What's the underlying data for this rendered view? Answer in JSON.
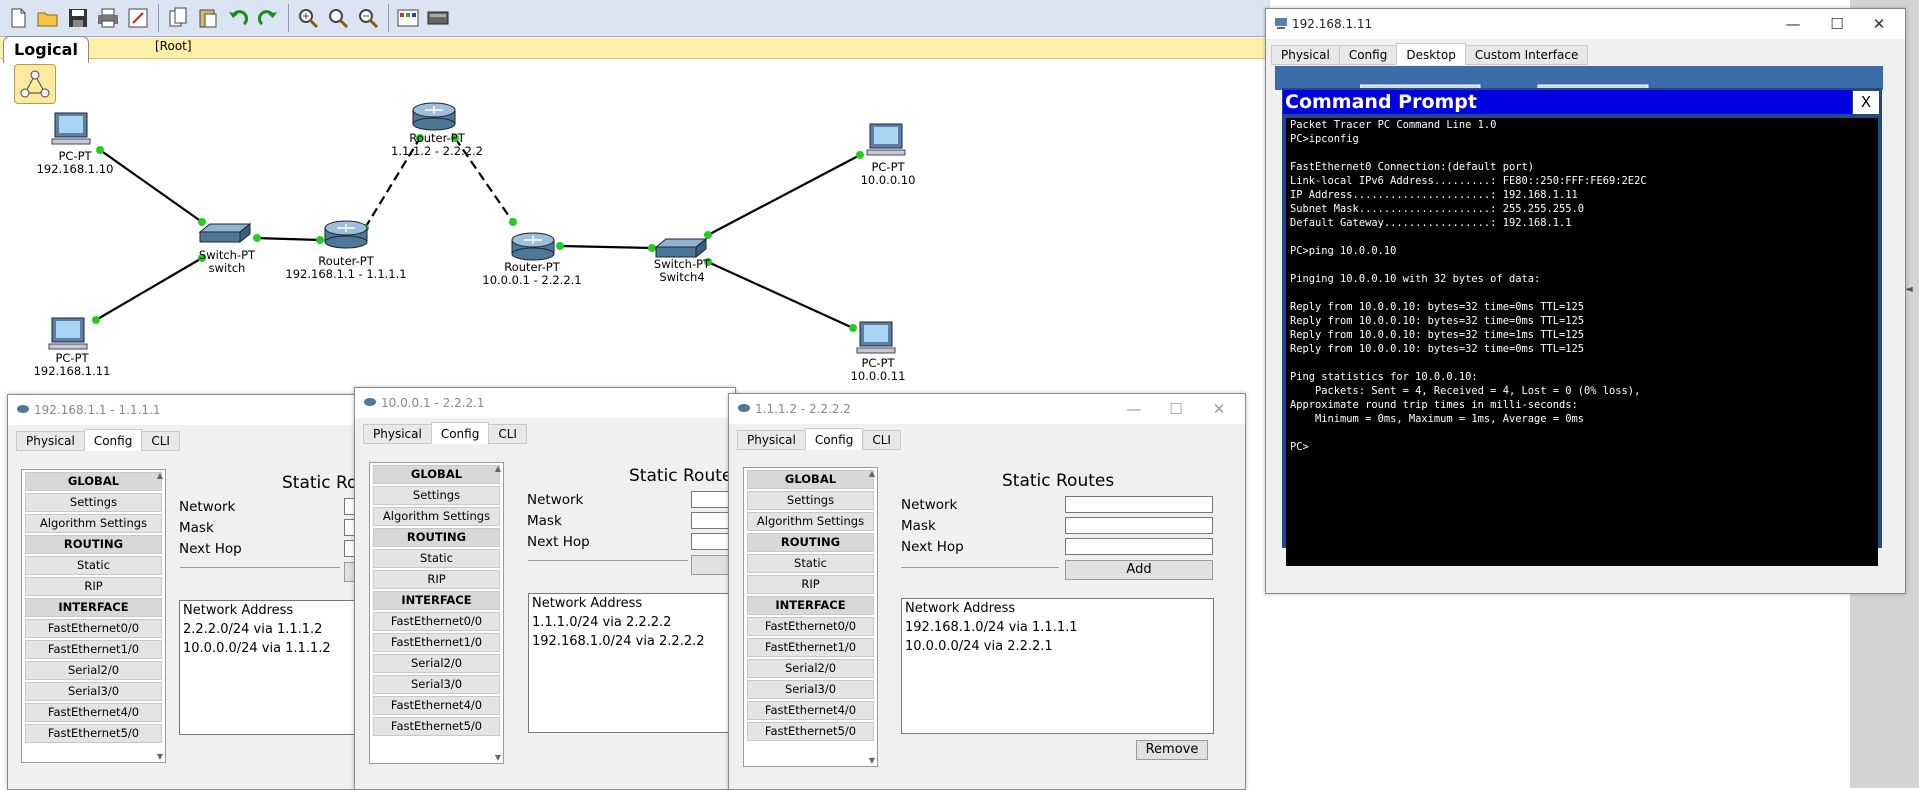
{
  "workspace": {
    "tab_label": "Logical",
    "root_label": "[Root]"
  },
  "topology": {
    "pc_tl": {
      "type": "PC-PT",
      "name": "192.168.1.10"
    },
    "pc_bl": {
      "type": "PC-PT",
      "name": "192.168.1.11"
    },
    "switch_left": {
      "type": "Switch-PT",
      "name": "switch"
    },
    "router_left": {
      "type": "Router-PT",
      "name": "192.168.1.1 - 1.1.1.1"
    },
    "router_top": {
      "type": "Router-PT",
      "name": "1.1.1.2 - 2.2.2.2"
    },
    "router_mid": {
      "type": "Router-PT",
      "name": "10.0.0.1 - 2.2.2.1"
    },
    "switch_right": {
      "type": "Switch-PT",
      "name": "Switch4"
    },
    "pc_tr": {
      "type": "PC-PT",
      "name": "10.0.0.10"
    },
    "pc_br": {
      "type": "PC-PT",
      "name": "10.0.0.11"
    }
  },
  "pc_window": {
    "title": "192.168.1.11",
    "tabs": [
      "Physical",
      "Config",
      "Desktop",
      "Custom Interface"
    ],
    "active_tab": "Desktop",
    "cmd_title": "Command Prompt",
    "cmd_close": "X",
    "cmd_lines": [
      "Packet Tracer PC Command Line 1.0",
      "PC>ipconfig",
      "",
      "FastEthernet0 Connection:(default port)",
      "Link-local IPv6 Address.........: FE80::250:FFF:FE69:2E2C",
      "IP Address......................: 192.168.1.11",
      "Subnet Mask.....................: 255.255.255.0",
      "Default Gateway.................: 192.168.1.1",
      "",
      "PC>ping 10.0.0.10",
      "",
      "Pinging 10.0.0.10 with 32 bytes of data:",
      "",
      "Reply from 10.0.0.10: bytes=32 time=0ms TTL=125",
      "Reply from 10.0.0.10: bytes=32 time=0ms TTL=125",
      "Reply from 10.0.0.10: bytes=32 time=1ms TTL=125",
      "Reply from 10.0.0.10: bytes=32 time=0ms TTL=125",
      "",
      "Ping statistics for 10.0.0.10:",
      "    Packets: Sent = 4, Received = 4, Lost = 0 (0% loss),",
      "Approximate round trip times in milli-seconds:",
      "    Minimum = 0ms, Maximum = 1ms, Average = 0ms",
      "",
      "PC>"
    ]
  },
  "router_tabs": [
    "Physical",
    "Config",
    "CLI"
  ],
  "router_side_items": [
    {
      "label": "GLOBAL",
      "header": true
    },
    {
      "label": "Settings",
      "header": false
    },
    {
      "label": "Algorithm Settings",
      "header": false
    },
    {
      "label": "ROUTING",
      "header": true
    },
    {
      "label": "Static",
      "header": false
    },
    {
      "label": "RIP",
      "header": false
    },
    {
      "label": "INTERFACE",
      "header": true
    },
    {
      "label": "FastEthernet0/0",
      "header": false
    },
    {
      "label": "FastEthernet1/0",
      "header": false
    },
    {
      "label": "Serial2/0",
      "header": false
    },
    {
      "label": "Serial3/0",
      "header": false
    },
    {
      "label": "FastEthernet4/0",
      "header": false
    },
    {
      "label": "FastEthernet5/0",
      "header": false
    }
  ],
  "static_routes": {
    "title_partial_1": "Static Ro",
    "title_partial_2": "Static Route",
    "title_full": "Static Routes",
    "network_label": "Network",
    "mask_label": "Mask",
    "next_hop_label": "Next Hop",
    "add_label": "Add",
    "remove_label": "Remove",
    "network_address_header": "Network Address"
  },
  "router_window_1": {
    "title": "192.168.1.1 - 1.1.1.1",
    "routes": [
      "2.2.2.0/24 via 1.1.1.2",
      "10.0.0.0/24 via 1.1.1.2"
    ]
  },
  "router_window_2": {
    "title": "10.0.0.1 - 2.2.2.1",
    "routes": [
      "1.1.1.0/24 via 2.2.2.2",
      "192.168.1.0/24 via 2.2.2.2"
    ]
  },
  "router_window_3": {
    "title": "1.1.1.2 - 2.2.2.2",
    "routes": [
      "192.168.1.0/24 via 1.1.1.1",
      "10.0.0.0/24 via 2.2.2.1"
    ]
  },
  "colors": {
    "link_green": "#22cc22",
    "cmd_blue": "#0000e0",
    "toolbar_bg": "#dbe4f2",
    "logical_bar": "#fcf0a8"
  }
}
